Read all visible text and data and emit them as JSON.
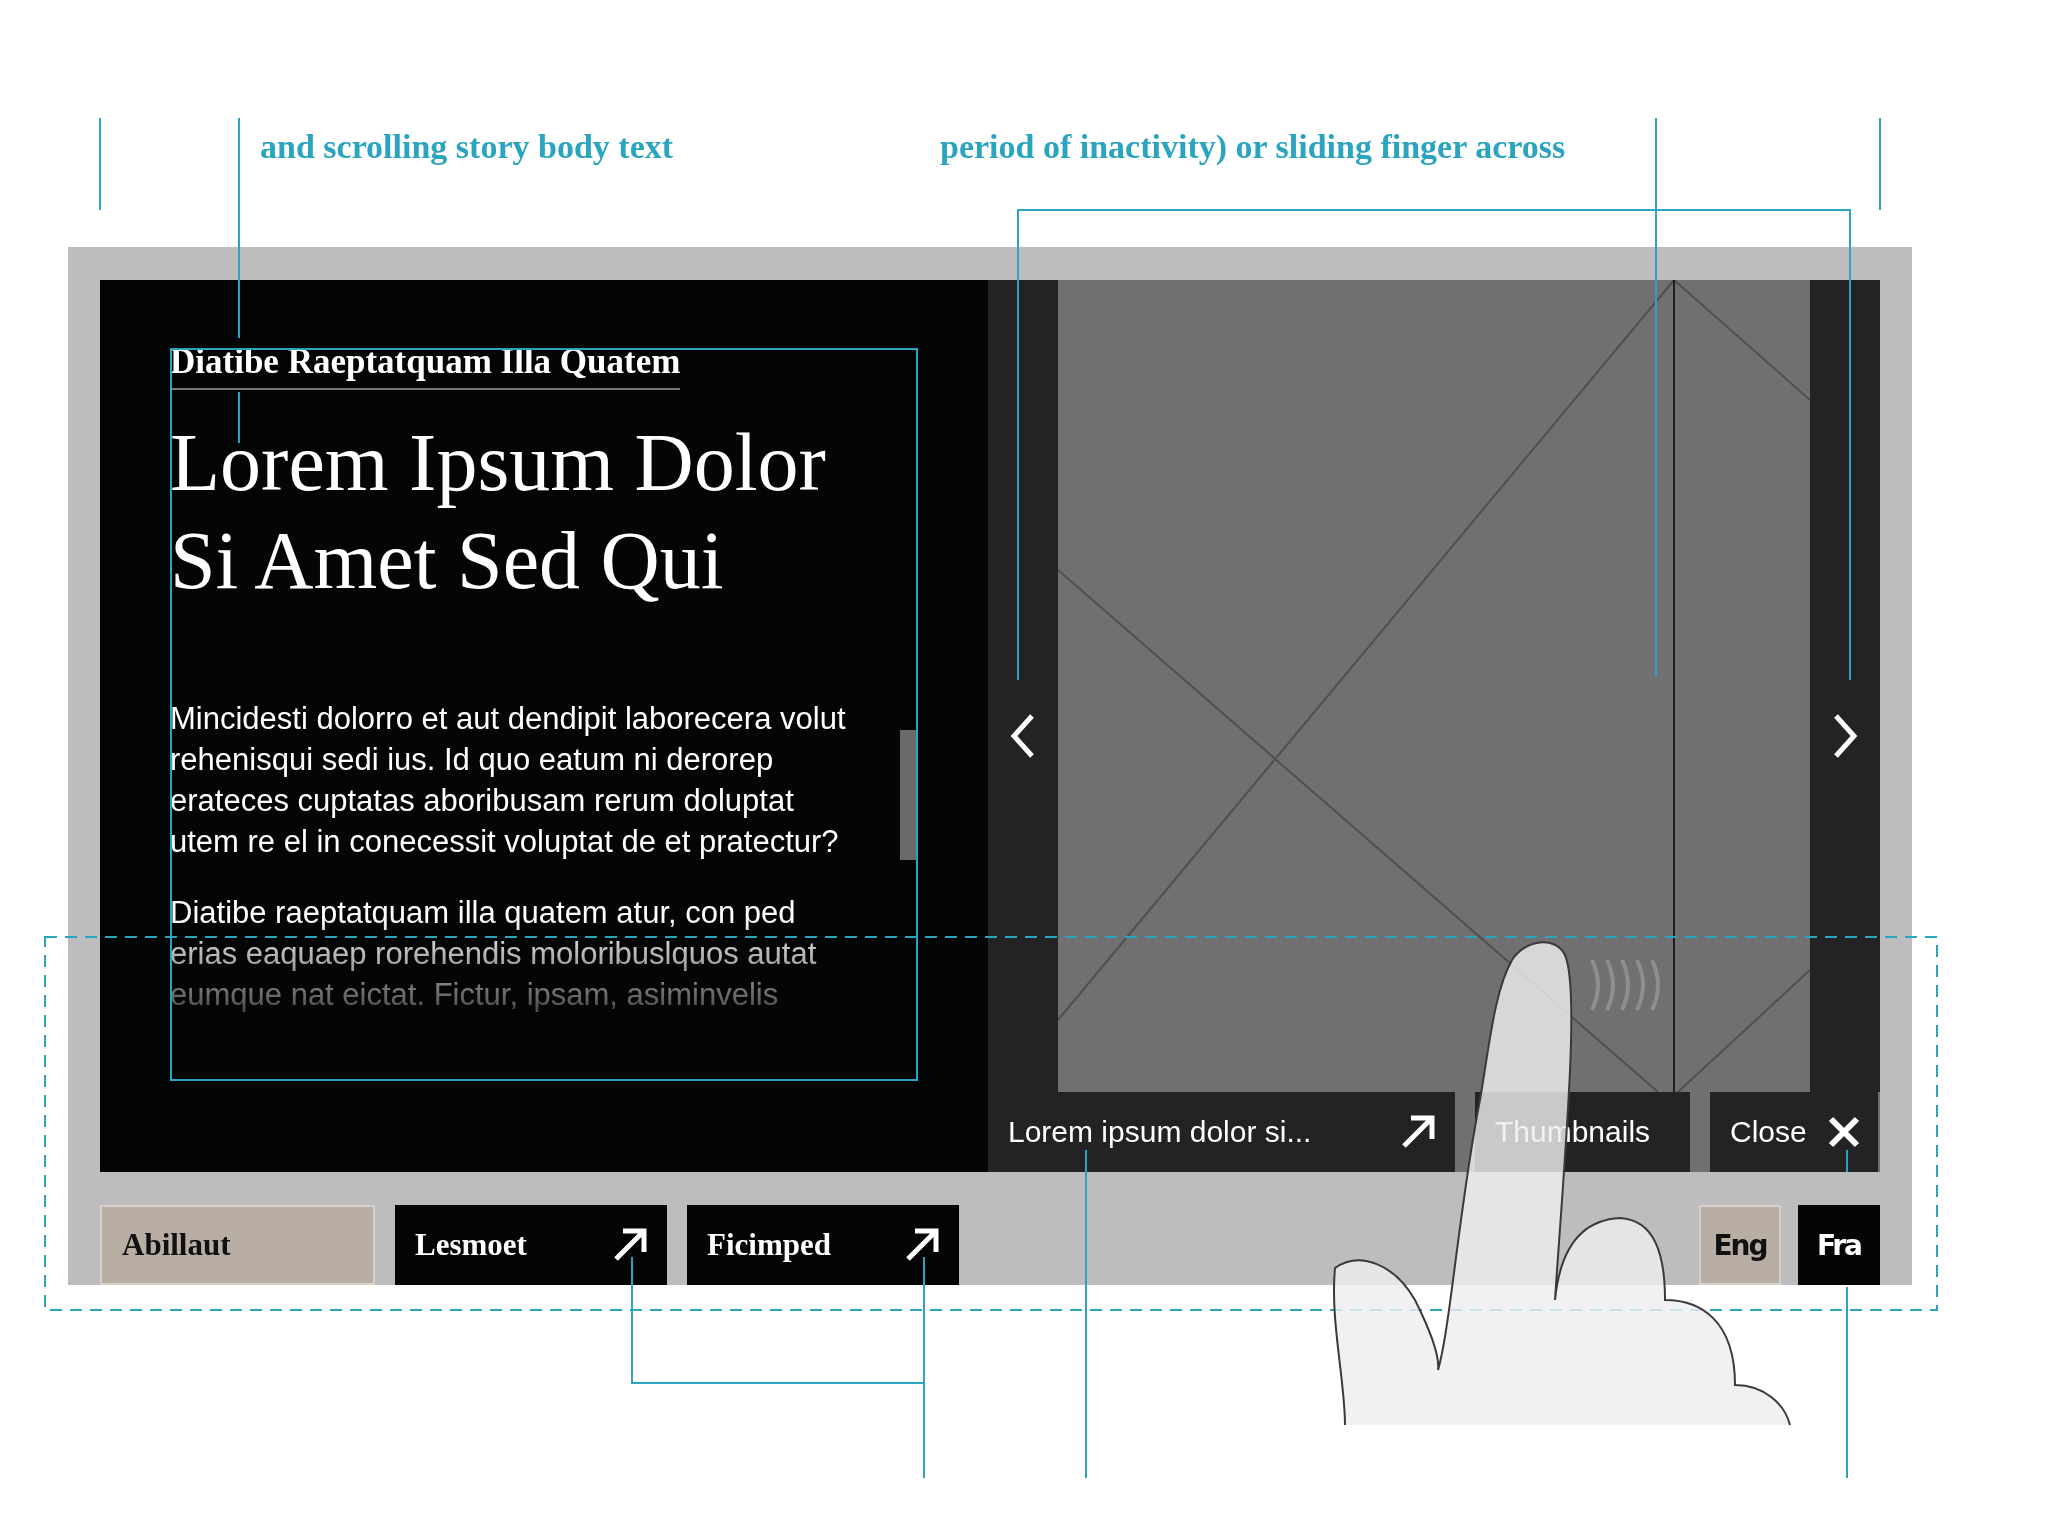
{
  "annotations": {
    "top_notes": [
      "and scrolling story body text",
      "period of inactivity) or sliding finger across"
    ]
  },
  "story": {
    "kicker": "Diatibe Raeptatquam Illa Quatem",
    "headline": "Lorem Ipsum Dolor Si Amet Sed Qui",
    "paragraphs": [
      {
        "text": "Mincidesti dolorro et aut dendipit laborecera volut rehenisqui sedi ius. Id quo eatum ni derorep erateces cuptatas aboribusam rerum doluptat utem re el in conecessit voluptat de et pratectur?",
        "faded": false
      },
      {
        "text": "Diatibe raeptatquam illa quatem atur, con ped erias eaquaep rorehendis moloribuslquos autat eumque nat eictat. Fictur, ipsam, asiminvelis",
        "faded": true
      }
    ]
  },
  "gallery": {
    "caption": "Lorem ipsum dolor si...",
    "buttons": [
      {
        "label": "Thumbnails",
        "kind": "thumbnails"
      },
      {
        "label": "Close",
        "kind": "close"
      }
    ]
  },
  "sections": [
    {
      "label": "Abillaut",
      "selected": true
    },
    {
      "label": "Lesmoet",
      "selected": false
    },
    {
      "label": "Ficimped",
      "selected": false
    }
  ],
  "languages": [
    {
      "label": "Eng",
      "selected": true
    },
    {
      "label": "Fra",
      "selected": false
    }
  ]
}
